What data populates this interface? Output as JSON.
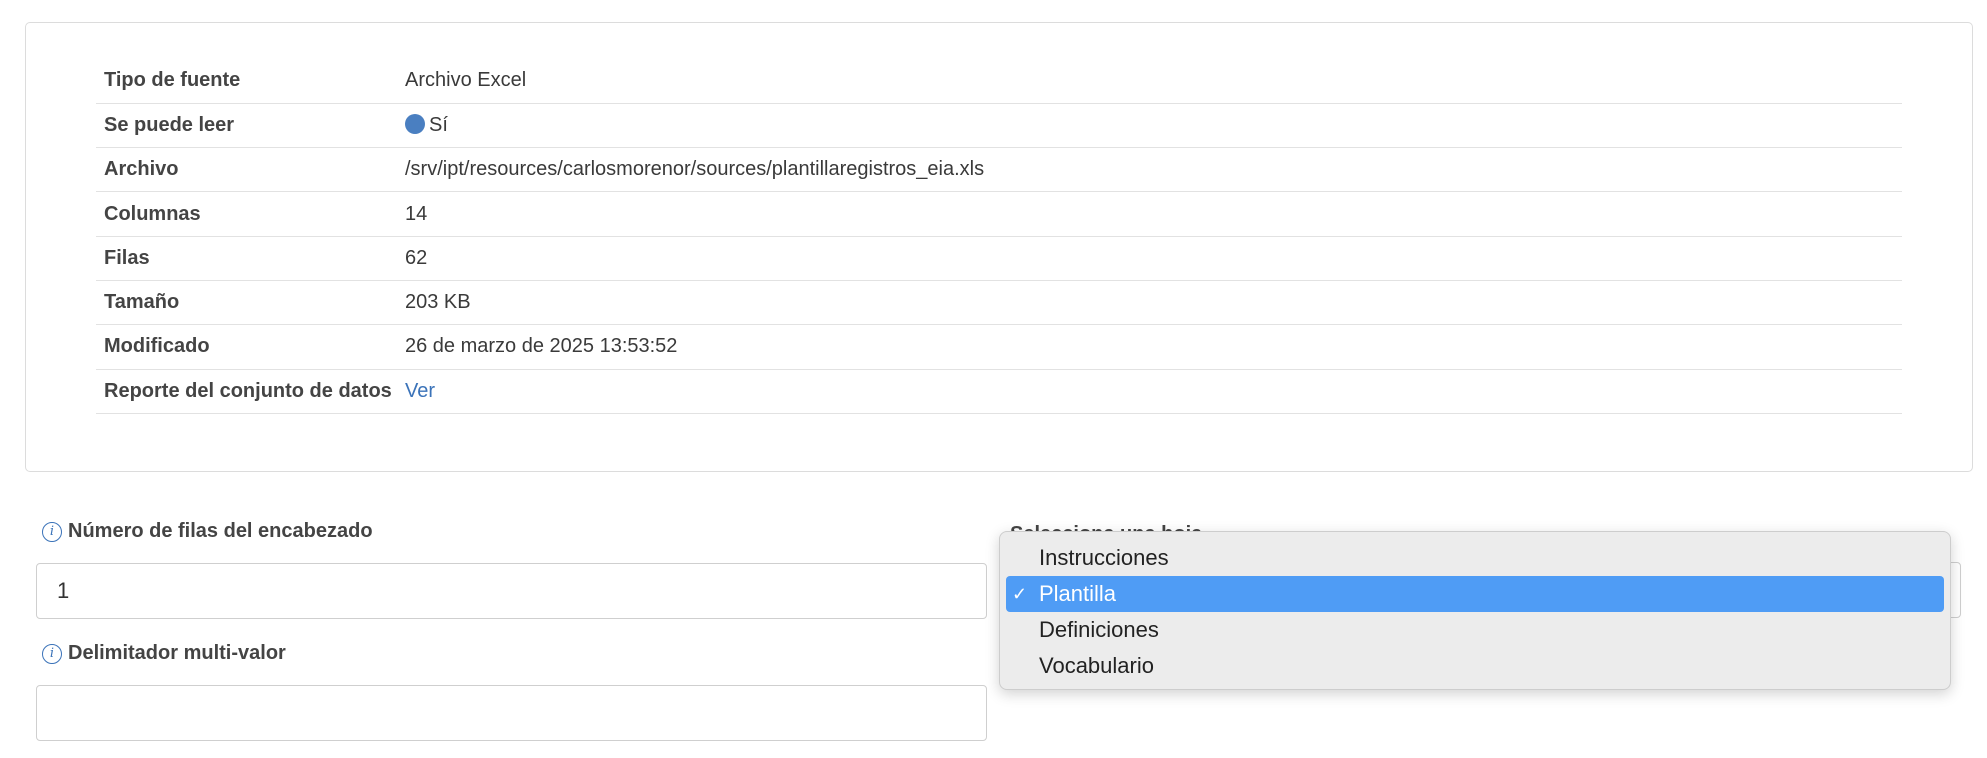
{
  "source_info": {
    "rows": [
      {
        "key": "Tipo de fuente",
        "value": "Archivo Excel"
      },
      {
        "key": "Se puede leer",
        "value": "Sí"
      },
      {
        "key": "Archivo",
        "value": "/srv/ipt/resources/carlosmorenor/sources/plantillaregistros_eia.xls"
      },
      {
        "key": "Columnas",
        "value": "14"
      },
      {
        "key": "Filas",
        "value": "62"
      },
      {
        "key": "Tamaño",
        "value": "203 KB"
      },
      {
        "key": "Modificado",
        "value": "26 de marzo de 2025 13:53:52"
      },
      {
        "key": "Reporte del conjunto de datos",
        "value": "Ver"
      }
    ]
  },
  "form": {
    "header_rows": {
      "label": "Número de filas del encabezado",
      "value": "1"
    },
    "multi_delimiter": {
      "label": "Delimitador multi-valor",
      "value": ""
    },
    "sheet_select": {
      "label": "Selecciona una hoja",
      "selected": "Plantilla"
    }
  },
  "sheet_dropdown": {
    "options": [
      "Instrucciones",
      "Plantilla",
      "Definiciones",
      "Vocabulario"
    ],
    "check_mark": "✓"
  },
  "colors": {
    "link": "#3b73b9",
    "selected_option": "#4f9cf5"
  }
}
